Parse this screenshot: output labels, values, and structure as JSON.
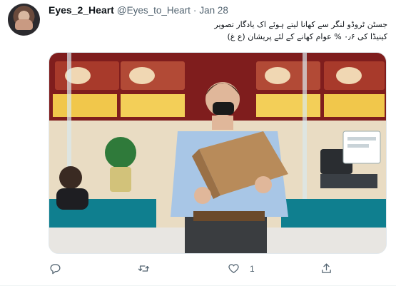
{
  "tweet": {
    "display_name": "Eyes_2_Heart",
    "handle": "@Eyes_to_Heart",
    "separator": "·",
    "date": "Jan 28",
    "text_line1": "جسٹن ٹروڈو لنگر سے کھانا لیتے ہوئے اک یادگار تصویر",
    "text_line2": "کینیڈا کی ۰٫۶ % عوام کھانے کے لئے پریشان (ع غ)"
  },
  "actions": {
    "reply_count": "",
    "retweet_count": "",
    "like_count": "1",
    "share_count": ""
  },
  "icons": {
    "reply": "reply-icon",
    "retweet": "retweet-icon",
    "like": "heart-icon",
    "share": "share-icon"
  }
}
